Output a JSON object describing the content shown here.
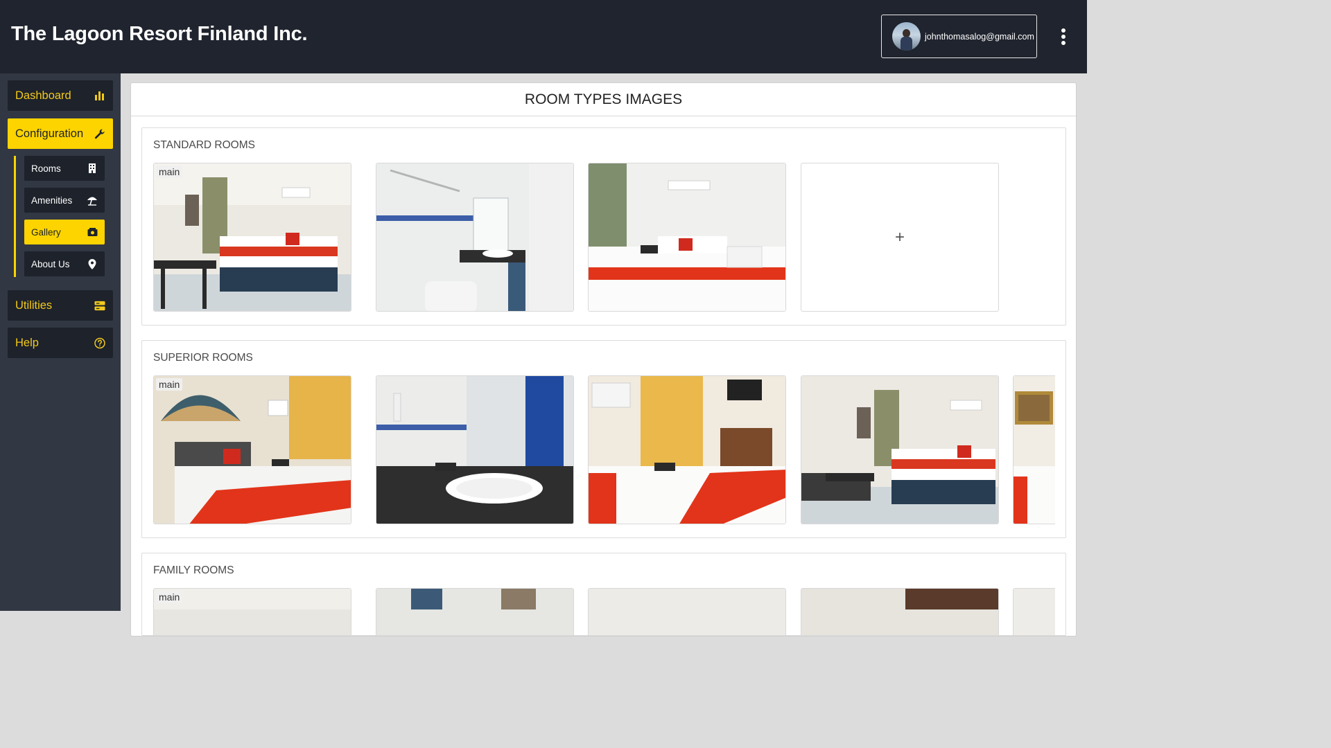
{
  "app": {
    "title": "The Lagoon Resort Finland Inc."
  },
  "user": {
    "email": "johnthomasalog@gmail.com"
  },
  "sidebar": {
    "items": [
      {
        "label": "Dashboard",
        "icon": "bar-chart-icon"
      },
      {
        "label": "Configuration",
        "icon": "wrench-icon",
        "active": true
      },
      {
        "label": "Utilities",
        "icon": "storage-icon"
      },
      {
        "label": "Help",
        "icon": "help-circle-icon"
      }
    ],
    "sub_items": [
      {
        "label": "Rooms",
        "icon": "building-icon"
      },
      {
        "label": "Amenities",
        "icon": "beach-umbrella-icon"
      },
      {
        "label": "Gallery",
        "icon": "gallery-icon",
        "active": true
      },
      {
        "label": "About Us",
        "icon": "map-pin-icon"
      }
    ]
  },
  "page": {
    "title": "ROOM TYPES IMAGES"
  },
  "sections": [
    {
      "title": "STANDARD ROOMS",
      "main_tag": "main",
      "add_label": "+"
    },
    {
      "title": "SUPERIOR ROOMS",
      "main_tag": "main"
    },
    {
      "title": "FAMILY ROOMS",
      "main_tag": "main"
    }
  ],
  "colors": {
    "header_bg": "#20242e",
    "sidebar_bg": "#313743",
    "nav_bg": "#1d222b",
    "accent": "#fdd400",
    "accent_text": "#f2c91c"
  }
}
